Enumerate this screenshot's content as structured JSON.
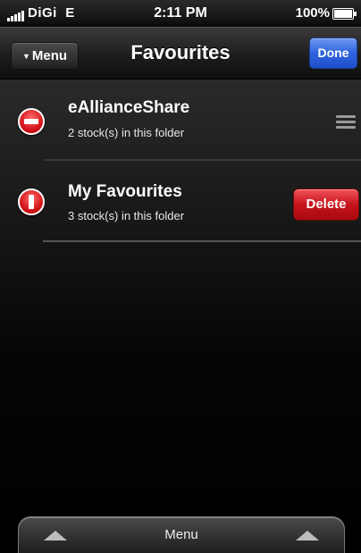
{
  "status_bar": {
    "carrier": "DiGi",
    "network": "E",
    "time": "2:11 PM",
    "battery": "100%"
  },
  "nav": {
    "menu_label": "Menu",
    "title": "Favourites",
    "done_label": "Done"
  },
  "folders": [
    {
      "name": "eAllianceShare",
      "detail": "2 stock(s) in this folder"
    },
    {
      "name": "My Favourites",
      "detail": "3 stock(s) in this folder"
    }
  ],
  "delete_label": "Delete",
  "bottom_tab": {
    "label": "Menu"
  },
  "colors": {
    "done_blue": "#2f63de",
    "delete_red": "#c8141c"
  }
}
